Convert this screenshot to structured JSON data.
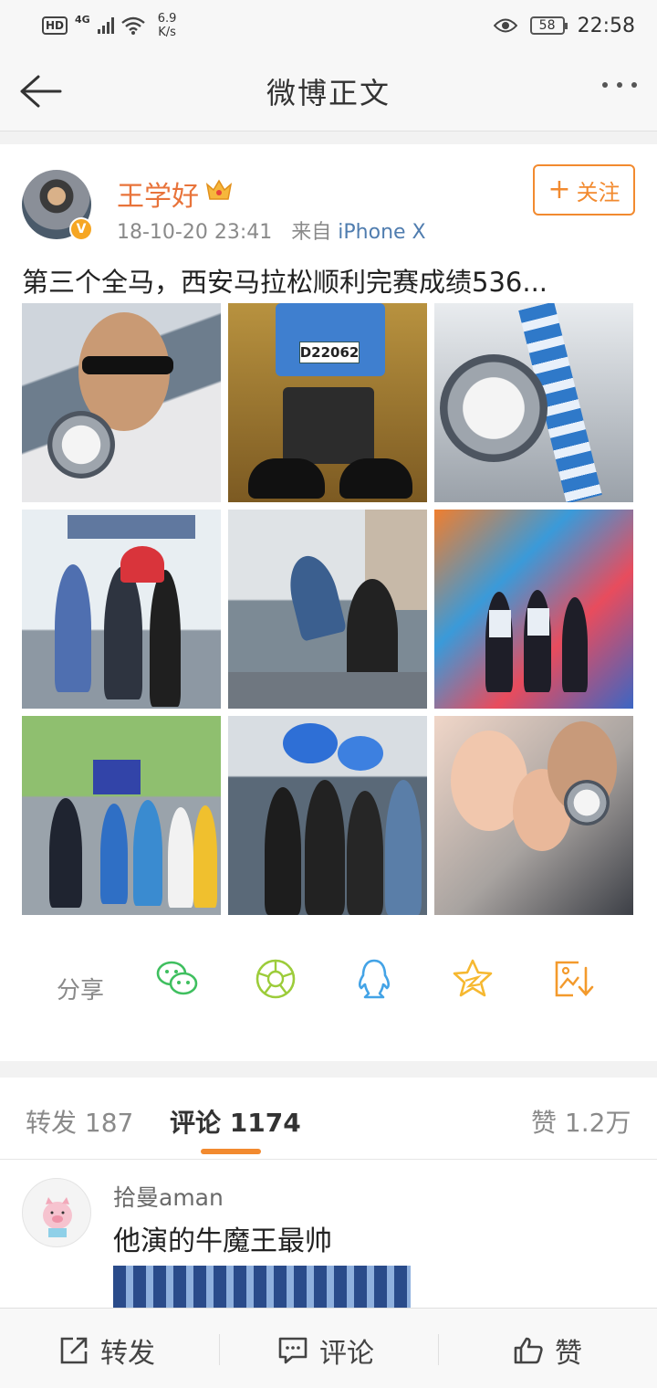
{
  "status_bar": {
    "hd": "HD",
    "network": "4G",
    "speed_value": "6.9",
    "speed_unit": "K/s",
    "battery": "58",
    "time": "22:58"
  },
  "nav": {
    "title": "微博正文"
  },
  "post": {
    "username": "王学好",
    "timestamp": "18-10-20 23:41",
    "source_prefix": "来自",
    "source": "iPhone X",
    "follow_label": "关注",
    "text": "第三个全马，西安马拉松顺利完赛成绩536...",
    "photo_bib": "D22062"
  },
  "share": {
    "label": "分享",
    "targets": [
      "wechat-icon",
      "moments-icon",
      "qq-icon",
      "qzone-icon",
      "save-image-icon"
    ]
  },
  "tabs": {
    "repost_label": "转发",
    "repost_count": "187",
    "comment_label": "评论",
    "comment_count": "1174",
    "like_label": "赞",
    "like_count": "1.2万"
  },
  "comment": {
    "username": "拾曼aman",
    "text": "他演的牛魔王最帅"
  },
  "bottom_bar": {
    "repost": "转发",
    "comment": "评论",
    "like": "赞"
  },
  "colors": {
    "accent": "#f28a2f",
    "username": "#e8733a",
    "link": "#507daf"
  }
}
